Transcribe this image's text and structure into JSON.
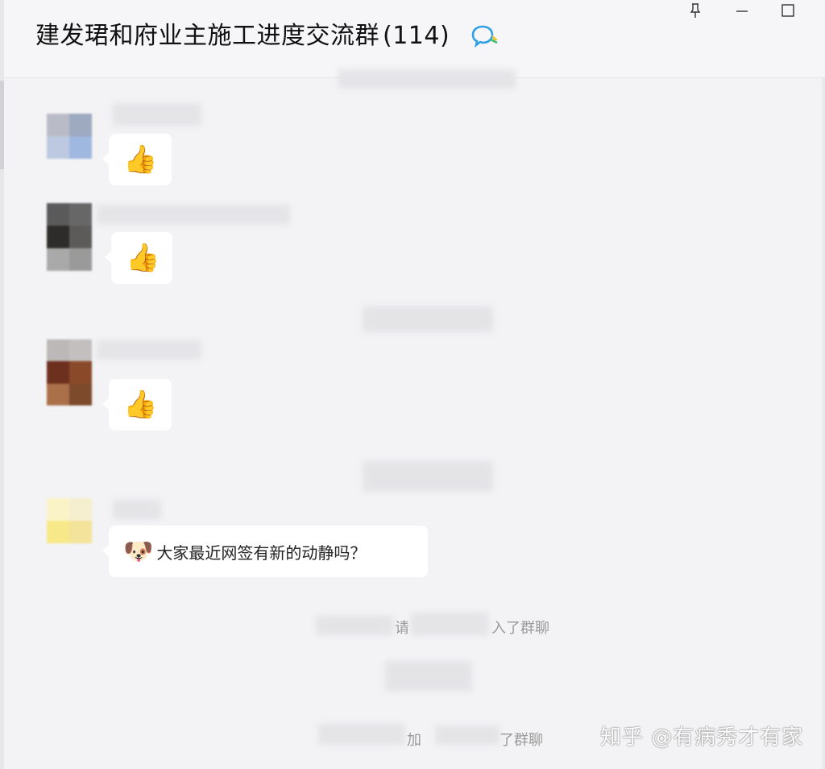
{
  "window": {
    "title": "建发珺和府业主施工进度交流群",
    "member_count": "(114)"
  },
  "messages": [
    {
      "type": "sticker",
      "sticker": "thumbs-up",
      "glyph": "👍"
    },
    {
      "type": "sticker",
      "sticker": "thumbs-up",
      "glyph": "👍"
    },
    {
      "type": "sticker",
      "sticker": "thumbs-up",
      "glyph": "👍"
    },
    {
      "type": "text",
      "emoji": "🐶",
      "text": "大家最近网签有新的动静吗？"
    }
  ],
  "system_notices": [
    {
      "part_a": "请",
      "part_b": "入了群聊"
    },
    {
      "part_a": "加",
      "part_b": "了群聊"
    }
  ],
  "watermark": "知乎 @有病秀才有家",
  "colors": {
    "background": "#f3f3f5",
    "bubble": "#ffffff",
    "icon_blue": "#2f9fe6"
  }
}
